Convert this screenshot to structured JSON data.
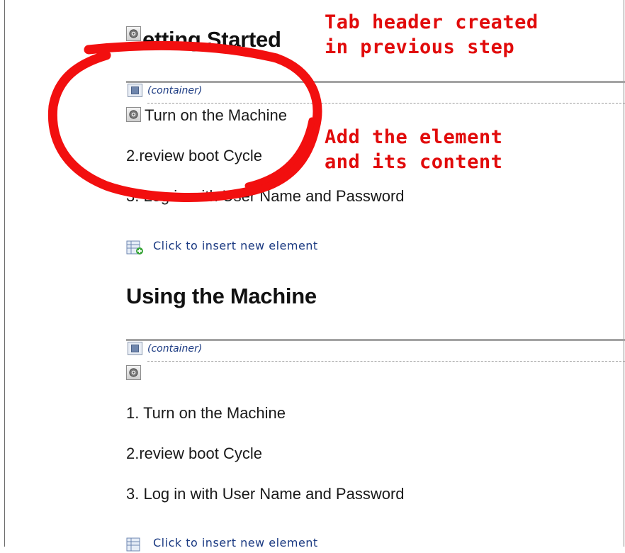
{
  "section1": {
    "title": "etting Started",
    "container_label": "(container)",
    "items": [
      "Turn on the Machine",
      "2.review boot Cycle",
      "3. Log in with User Name and Password"
    ],
    "insert_label": "Click to insert new element"
  },
  "section2": {
    "title": "Using the Machine",
    "container_label": "(container)",
    "items": [
      "1. Turn on the Machine",
      "2.review boot Cycle",
      "3. Log in with User Name and Password"
    ],
    "insert_label": "Click to insert new element"
  },
  "annotations": {
    "tab_header": [
      "Tab header created",
      "in previous step"
    ],
    "add_element": [
      "Add the element",
      "and its content"
    ]
  },
  "colors": {
    "annotation": "#e10b0b",
    "link": "#1b3a82"
  },
  "icons": [
    "gear-icon",
    "container-icon",
    "insert-element-icon"
  ]
}
